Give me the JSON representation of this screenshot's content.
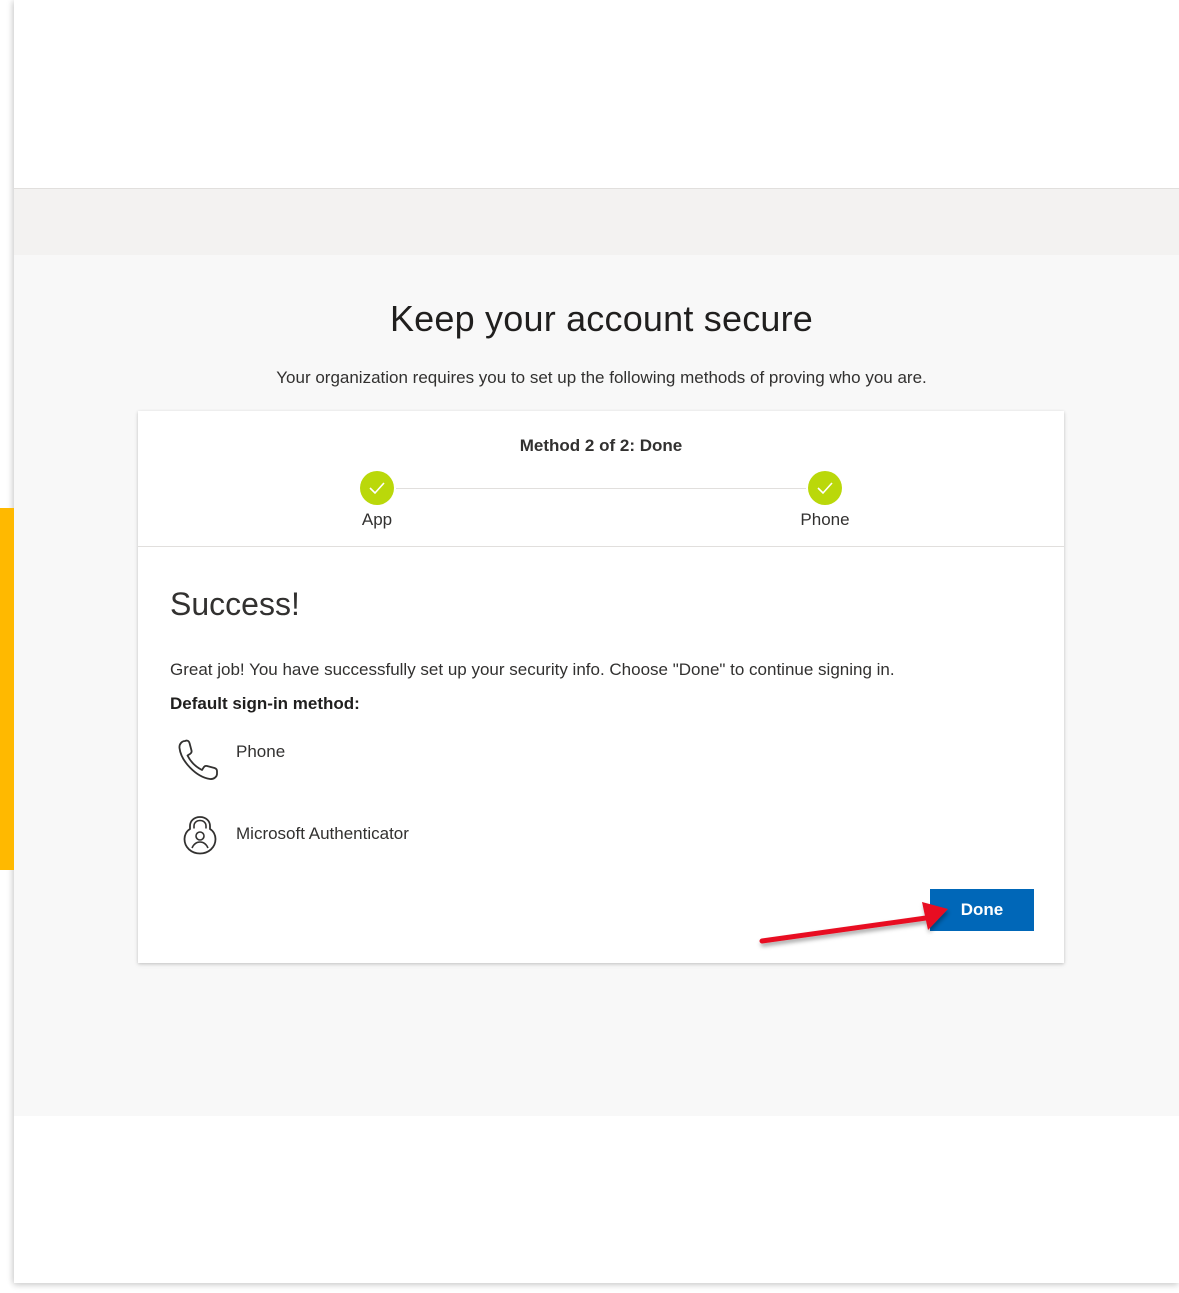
{
  "page": {
    "title": "Keep your account secure",
    "subtitle": "Your organization requires you to set up the following methods of proving who you are."
  },
  "progress": {
    "title": "Method 2 of 2: Done",
    "current_step": 2,
    "total_steps": 2,
    "steps": [
      {
        "label": "App",
        "status": "complete",
        "icon": "checkmark-icon"
      },
      {
        "label": "Phone",
        "status": "complete",
        "icon": "checkmark-icon"
      }
    ]
  },
  "result": {
    "heading": "Success!",
    "message": "Great job! You have successfully set up your security info. Choose \"Done\" to continue signing in.",
    "default_method_label": "Default sign-in method:",
    "methods": [
      {
        "label": "Phone",
        "icon": "phone-icon"
      },
      {
        "label": "Microsoft Authenticator",
        "icon": "authenticator-lock-icon"
      }
    ]
  },
  "actions": {
    "done_label": "Done"
  },
  "annotation": {
    "icon": "red-arrow-icon",
    "points_to": "done-button"
  },
  "colors": {
    "accent": "#0067b8",
    "step_complete": "#bad80a",
    "side_bar": "#ffb900",
    "annotation_arrow": "#e81123"
  }
}
